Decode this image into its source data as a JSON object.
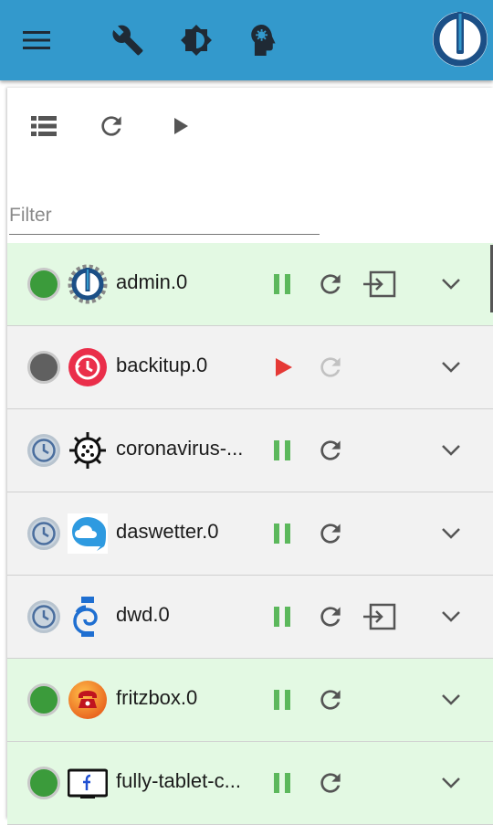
{
  "header": {
    "menu_icon": "menu-icon",
    "tools": [
      {
        "name": "wrench-icon"
      },
      {
        "name": "brightness-icon"
      },
      {
        "name": "expert-mode-icon"
      }
    ],
    "logo": "iobroker-logo",
    "colors": {
      "appbar": "#3399cc",
      "logo_ring": "#1b4f86"
    }
  },
  "toolbar": {
    "list_view_icon": "list-icon",
    "reload_icon": "reload-icon",
    "play_icon": "play-icon"
  },
  "filter": {
    "placeholder": "Filter",
    "value": ""
  },
  "instances": [
    {
      "name": "admin.0",
      "status": "running",
      "icon": "admin-gear-icon",
      "actions": [
        "pause",
        "restart",
        "logs"
      ]
    },
    {
      "name": "backitup.0",
      "status": "stopped",
      "icon": "backitup-icon",
      "actions": [
        "play",
        "restart-disabled"
      ]
    },
    {
      "name": "coronavirus-...",
      "status": "scheduled",
      "icon": "coronavirus-icon",
      "actions": [
        "pause",
        "restart"
      ]
    },
    {
      "name": "daswetter.0",
      "status": "scheduled",
      "icon": "cloud-icon",
      "actions": [
        "pause",
        "restart"
      ]
    },
    {
      "name": "dwd.0",
      "status": "scheduled",
      "icon": "dwd-swirl-icon",
      "actions": [
        "pause",
        "restart",
        "logs"
      ]
    },
    {
      "name": "fritzbox.0",
      "status": "running",
      "icon": "telephone-icon",
      "actions": [
        "pause",
        "restart"
      ]
    },
    {
      "name": "fully-tablet-c...",
      "status": "running",
      "icon": "tablet-icon",
      "actions": [
        "pause",
        "restart"
      ]
    }
  ],
  "colors": {
    "running_row": "#e3f9e3",
    "stopped_row": "#f2f2f2",
    "pause_green": "#5cb85c",
    "play_red": "#e53935"
  }
}
